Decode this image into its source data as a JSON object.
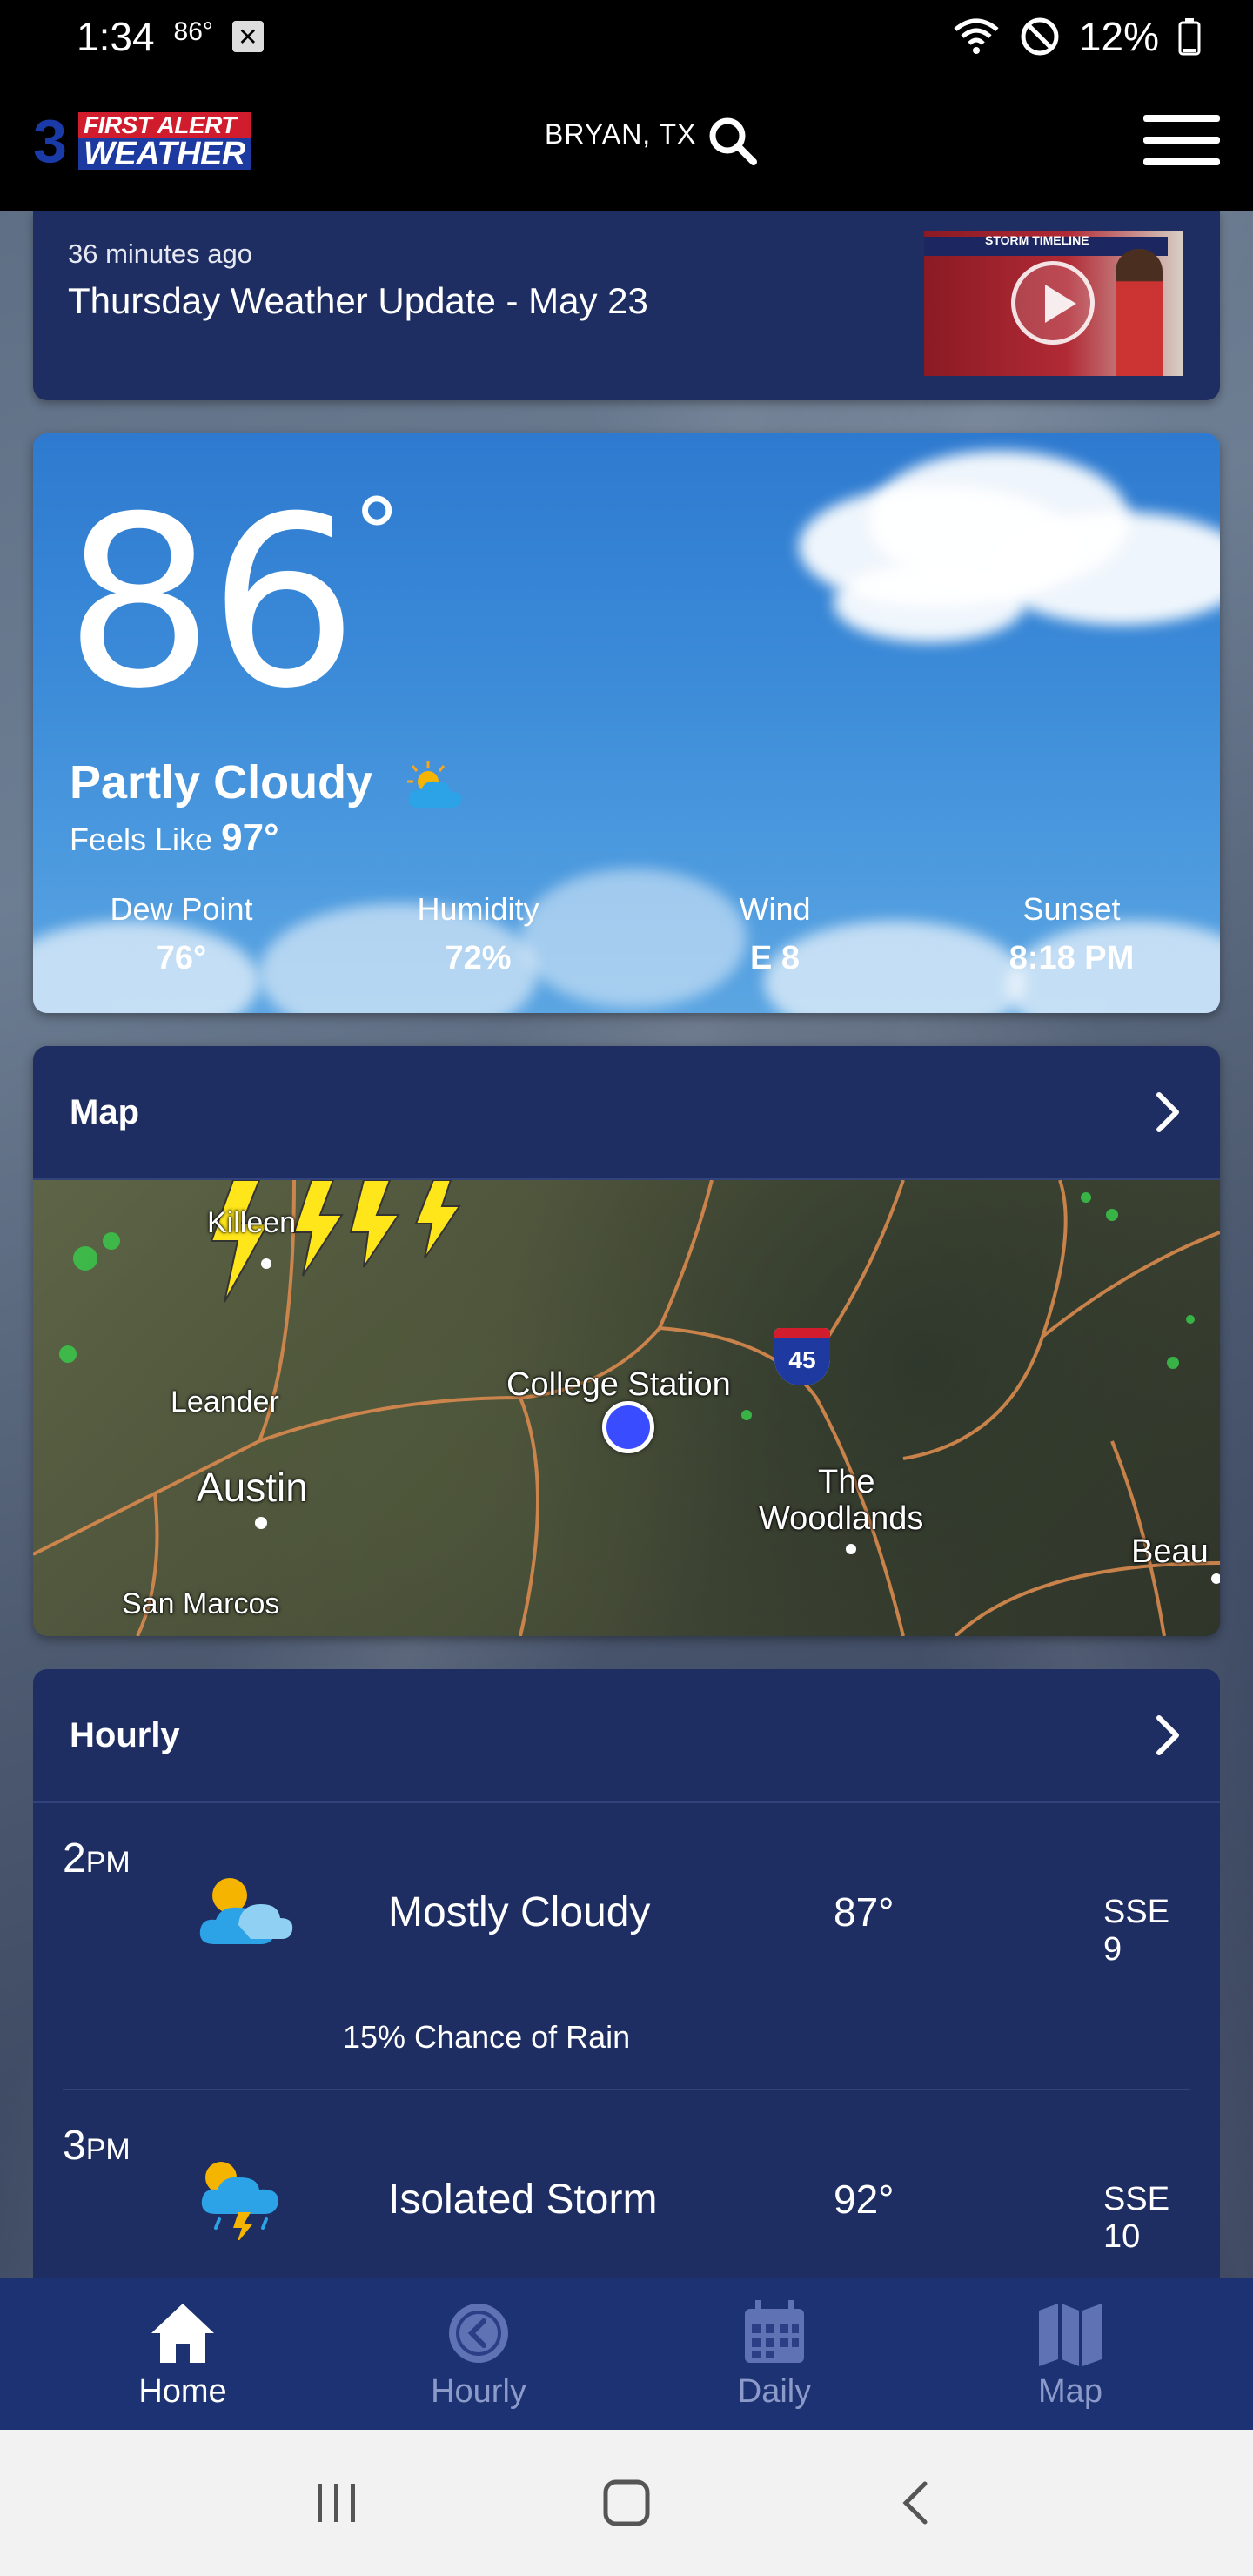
{
  "status_bar": {
    "time": "1:34",
    "temp": "86°",
    "battery": "12%"
  },
  "header": {
    "location": "BRYAN, TX",
    "logo_line1": "FIRST ALERT",
    "logo_line2": "WEATHER",
    "logo_mark": "3"
  },
  "video": {
    "time_ago": "36 minutes ago",
    "title": "Thursday Weather Update - May 23",
    "thumb_header": "STORM TIMELINE"
  },
  "current": {
    "temperature": "86",
    "degree": "°",
    "condition": "Partly Cloudy",
    "feels_like_label": "Feels Like",
    "feels_like_value": "97°",
    "stats": [
      {
        "label": "Dew Point",
        "value": "76°"
      },
      {
        "label": "Humidity",
        "value": "72%"
      },
      {
        "label": "Wind",
        "value": "E 8"
      },
      {
        "label": "Sunset",
        "value": "8:18 PM"
      }
    ]
  },
  "map": {
    "title": "Map",
    "labels": {
      "leander": "Leander",
      "austin": "Austin",
      "san_marcos": "San Marcos",
      "college_station": "College Station",
      "the": "The",
      "woodlands": "Woodlands",
      "beau": "Beau",
      "killeen": "Killeen"
    },
    "highway": "45"
  },
  "hourly": {
    "title": "Hourly",
    "rows": [
      {
        "hour": "2",
        "ampm": "PM",
        "condition": "Mostly Cloudy",
        "temp": "87°",
        "wind": "SSE 9",
        "rain": "15% Chance of Rain",
        "icon": "mostly-cloudy-icon"
      },
      {
        "hour": "3",
        "ampm": "PM",
        "condition": "Isolated Storm",
        "temp": "92°",
        "wind": "SSE 10",
        "icon": "storm-icon"
      }
    ]
  },
  "tabs": [
    {
      "label": "Home",
      "active": true
    },
    {
      "label": "Hourly",
      "active": false
    },
    {
      "label": "Daily",
      "active": false
    },
    {
      "label": "Map",
      "active": false
    }
  ],
  "colors": {
    "card_bg": "#1e2d62",
    "tab_bar_bg": "#1c3272",
    "sky_blue": "#3b8ad8",
    "logo_red": "#d01c2c",
    "logo_blue": "#1d3aa0"
  }
}
